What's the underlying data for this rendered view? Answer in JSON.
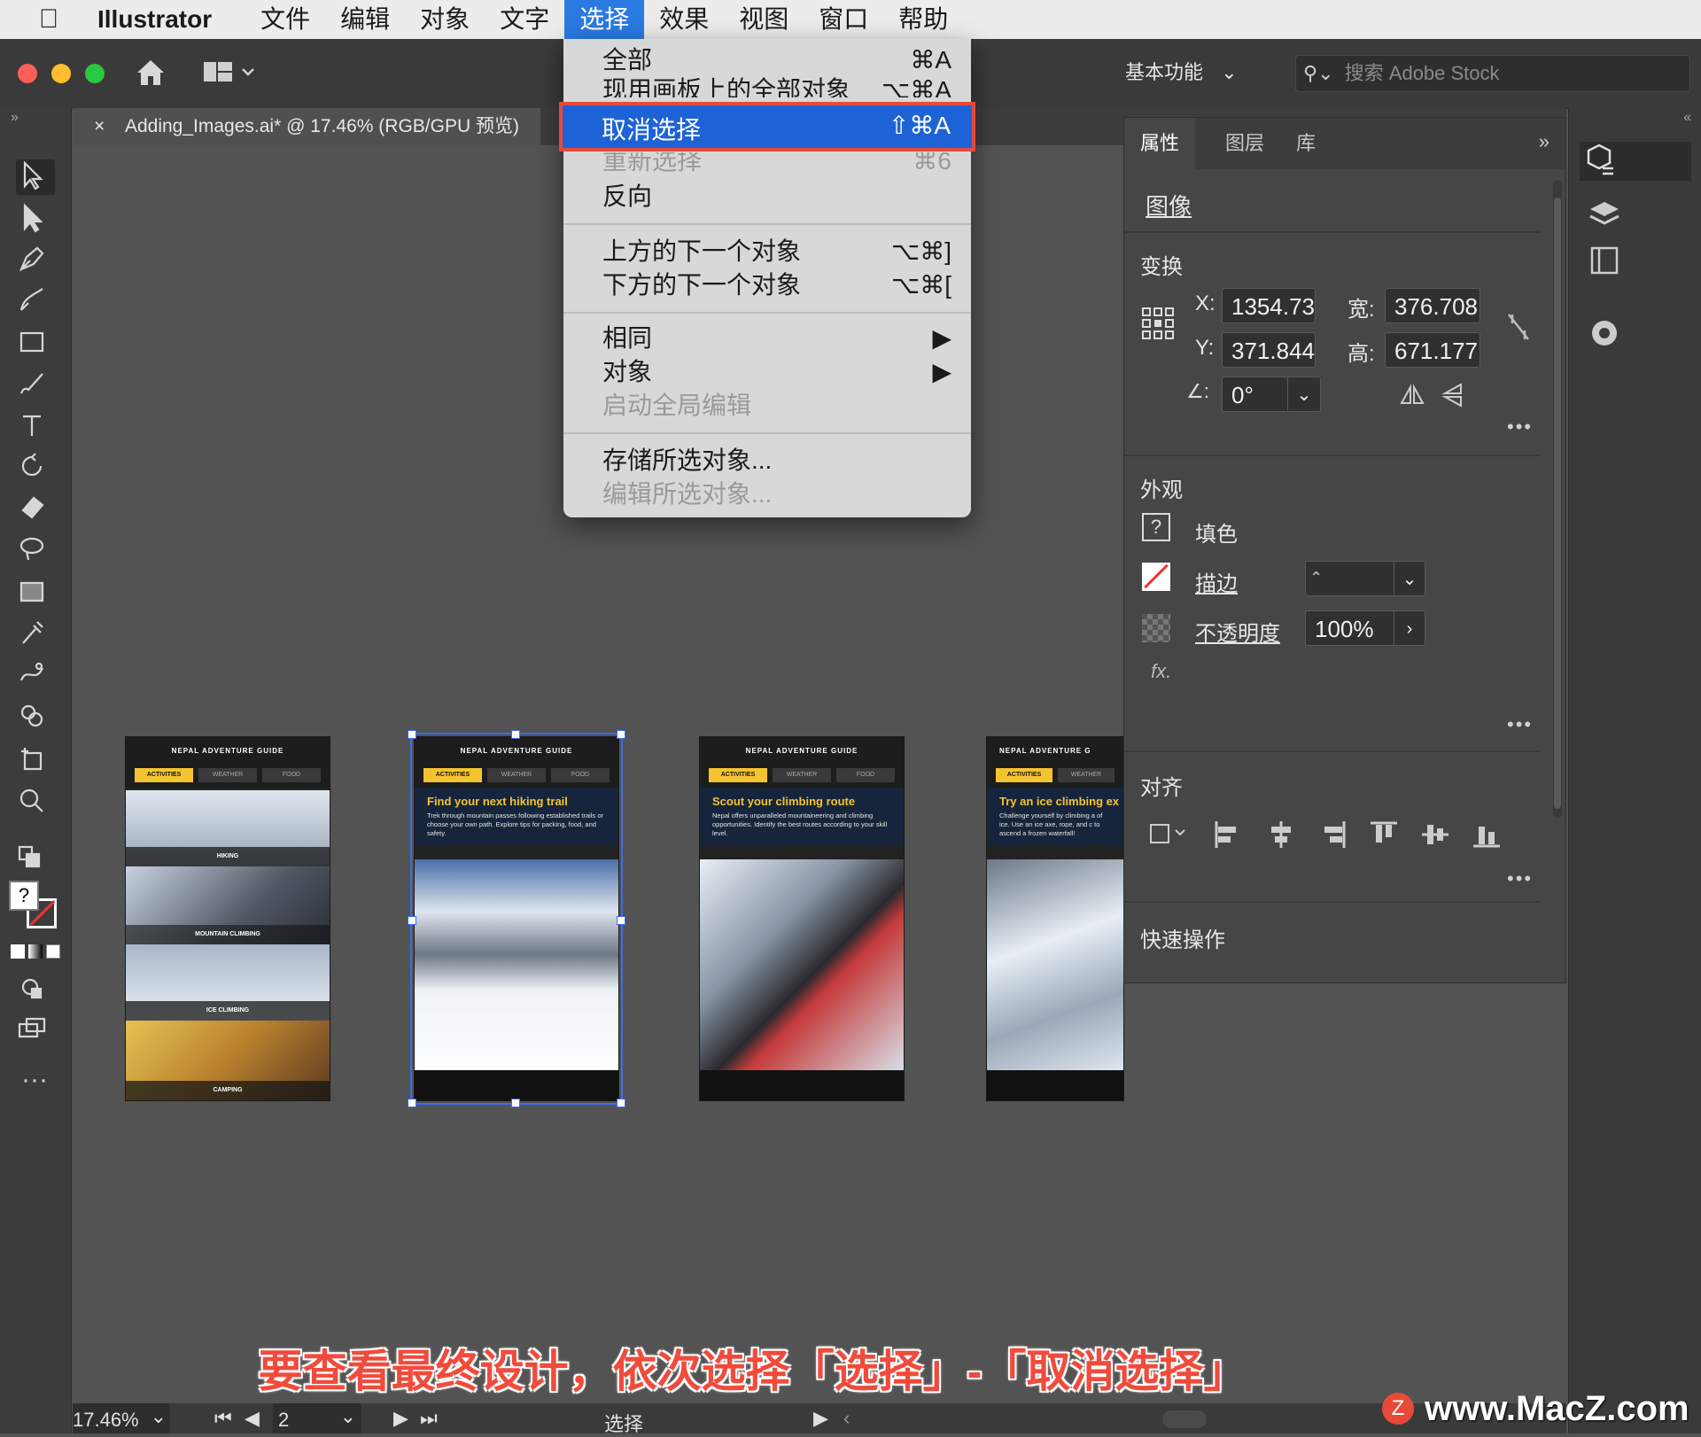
{
  "menubar": {
    "app": "Illustrator",
    "items": [
      "文件",
      "编辑",
      "对象",
      "文字",
      "选择",
      "效果",
      "视图",
      "窗口",
      "帮助"
    ]
  },
  "appbar": {
    "workspace": "基本功能",
    "stock_placeholder": "搜索 Adobe Stock"
  },
  "document": {
    "tab_close": "×",
    "tab_title": "Adding_Images.ai* @ 17.46% (RGB/GPU 预览)"
  },
  "select_menu": {
    "items": [
      {
        "label": "全部",
        "shortcut": "⌘A",
        "enabled": true
      },
      {
        "label": "现用画板上的全部对象",
        "shortcut": "⌥⌘A",
        "enabled": true
      },
      {
        "label": "取消选择",
        "shortcut": "⇧⌘A",
        "enabled": true,
        "highlighted": true
      },
      {
        "label": "重新选择",
        "shortcut": "⌘6",
        "enabled": false
      },
      {
        "label": "反向",
        "shortcut": "",
        "enabled": true
      },
      {
        "label": "上方的下一个对象",
        "shortcut": "⌥⌘]",
        "enabled": true
      },
      {
        "label": "下方的下一个对象",
        "shortcut": "⌥⌘[",
        "enabled": true
      },
      {
        "label": "相同",
        "shortcut": "▶",
        "enabled": true
      },
      {
        "label": "对象",
        "shortcut": "▶",
        "enabled": true
      },
      {
        "label": "启动全局编辑",
        "shortcut": "",
        "enabled": false
      },
      {
        "label": "存储所选对象...",
        "shortcut": "",
        "enabled": true
      },
      {
        "label": "编辑所选对象...",
        "shortcut": "",
        "enabled": false
      }
    ]
  },
  "artboards": [
    {
      "header": "NEPAL ADVENTURE GUIDE",
      "chips": [
        "ACTIVITIES",
        "WEATHER",
        "FOOD"
      ],
      "title": "",
      "title_accent": "",
      "desc": "",
      "labels": [
        "HIKING",
        "MOUNTAIN CLIMBING",
        "ICE CLIMBING",
        "CAMPING"
      ]
    },
    {
      "header": "NEPAL ADVENTURE GUIDE",
      "chips": [
        "ACTIVITIES",
        "WEATHER",
        "FOOD"
      ],
      "title": "Find your next ",
      "title_accent": "hiking trail",
      "desc": "Trek through mountain passes following established trails or choose your own path. Explore tips for packing, food, and safety."
    },
    {
      "header": "NEPAL ADVENTURE GUIDE",
      "chips": [
        "ACTIVITIES",
        "WEATHER",
        "FOOD"
      ],
      "title": "Scout your ",
      "title_accent": "climbing route",
      "desc": "Nepal offers unparalleled mountaineering and climbing opportunities. Identify the best routes according to your skill level."
    },
    {
      "header": "NEPAL ADVENTURE G",
      "chips": [
        "ACTIVITIES",
        "WEATHER"
      ],
      "title": "Try an ",
      "title_accent": "ice climbing ex",
      "desc": "Challenge yourself by climbing a of ice. Use an ice axe, rope, and c to ascend a frozen waterfall!"
    }
  ],
  "properties": {
    "tabs": [
      "属性",
      "图层",
      "库"
    ],
    "object_type": "图像",
    "transform_title": "变换",
    "x_label": "X:",
    "x_value": "1354.73",
    "y_label": "Y:",
    "y_value": "371.844",
    "w_label": "宽:",
    "w_value": "376.708",
    "h_label": "高:",
    "h_value": "671.177",
    "angle_value": "0°",
    "appearance_title": "外观",
    "fill_label": "填色",
    "stroke_label": "描边",
    "opacity_label": "不透明度",
    "opacity_value": "100%",
    "fx_label": "fx.",
    "align_title": "对齐",
    "quick_actions_title": "快速操作"
  },
  "status": {
    "zoom": "17.46%",
    "artboard": "2",
    "tool": "选择"
  },
  "caption": "要查看最终设计，依次选择「选择」-「取消选择」",
  "watermark": "www.MacZ.com",
  "colors": {
    "accent_yellow": "#f4c430",
    "menu_highlight": "#1d63d6",
    "callout_red": "#e64a3c"
  }
}
